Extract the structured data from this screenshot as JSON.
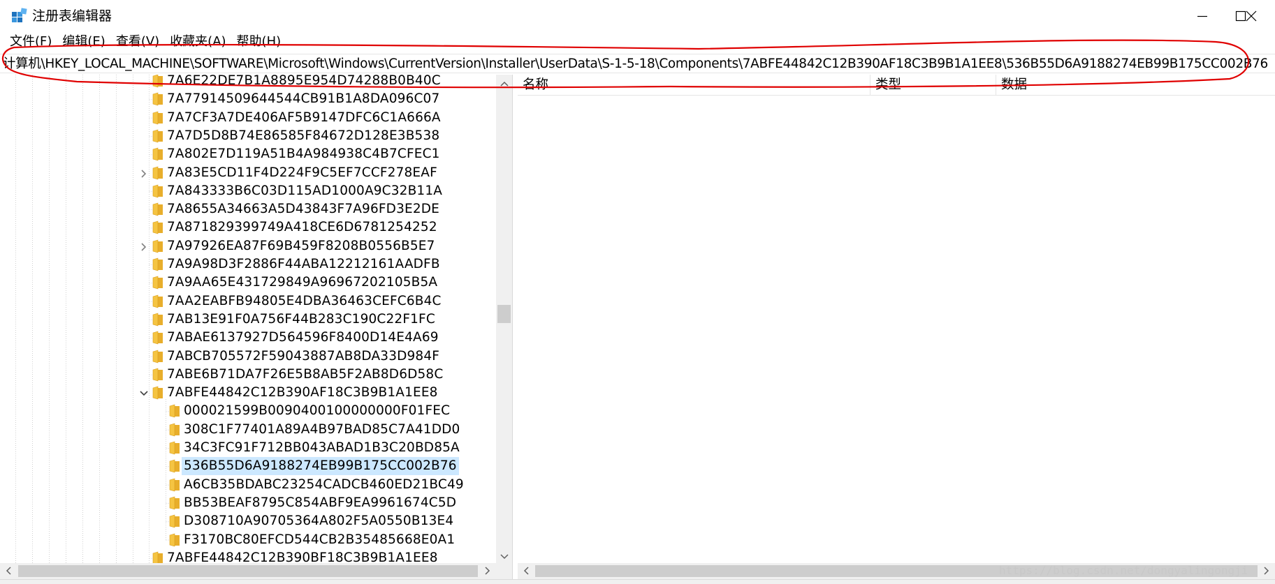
{
  "window": {
    "title": "注册表编辑器",
    "icon": "registry-editor-icon",
    "controls": {
      "minimize": "minimize-icon",
      "maximize": "maximize-icon",
      "close": "close-icon"
    }
  },
  "menu": [
    "文件(F)",
    "编辑(E)",
    "查看(V)",
    "收藏夹(A)",
    "帮助(H)"
  ],
  "address": "计算机\\HKEY_LOCAL_MACHINE\\SOFTWARE\\Microsoft\\Windows\\CurrentVersion\\Installer\\UserData\\S-1-5-18\\Components\\7ABFE44842C12B390AF18C3B9B1A1EE8\\536B55D6A9188274EB99B175CC002B76",
  "tree": {
    "selected_key": "536B55D6A9188274EB99B175CC002B76",
    "items": [
      {
        "label": "7A6E22DE7B1A8895E954D74288B0B40C",
        "level": 0,
        "expander": "none",
        "selected": false
      },
      {
        "label": "7A77914509644544CB91B1A8DA096C07",
        "level": 0,
        "expander": "none",
        "selected": false
      },
      {
        "label": "7A7CF3A7DE406AF5B9147DFC6C1A666A",
        "level": 0,
        "expander": "none",
        "selected": false
      },
      {
        "label": "7A7D5D8B74E86585F84672D128E3B538",
        "level": 0,
        "expander": "none",
        "selected": false
      },
      {
        "label": "7A802E7D119A51B4A984938C4B7CFEC1",
        "level": 0,
        "expander": "none",
        "selected": false
      },
      {
        "label": "7A83E5CD11F4D224F9C5EF7CCF278EAF",
        "level": 0,
        "expander": "collapsed",
        "selected": false
      },
      {
        "label": "7A843333B6C03D115AD1000A9C32B11A",
        "level": 0,
        "expander": "none",
        "selected": false
      },
      {
        "label": "7A8655A34663A5D43843F7A96FD3E2DE",
        "level": 0,
        "expander": "none",
        "selected": false
      },
      {
        "label": "7A871829399749A418CE6D6781254252",
        "level": 0,
        "expander": "none",
        "selected": false
      },
      {
        "label": "7A97926EA87F69B459F8208B0556B5E7",
        "level": 0,
        "expander": "collapsed",
        "selected": false
      },
      {
        "label": "7A9A98D3F2886F44ABA12212161AADFB",
        "level": 0,
        "expander": "none",
        "selected": false
      },
      {
        "label": "7A9AA65E431729849A96967202105B5A",
        "level": 0,
        "expander": "none",
        "selected": false
      },
      {
        "label": "7AA2EABFB94805E4DBA36463CEFC6B4C",
        "level": 0,
        "expander": "none",
        "selected": false
      },
      {
        "label": "7AB13E91F0A756F44B283C190C22F1FC",
        "level": 0,
        "expander": "none",
        "selected": false
      },
      {
        "label": "7ABAE6137927D564596F8400D14E4A69",
        "level": 0,
        "expander": "none",
        "selected": false
      },
      {
        "label": "7ABCB705572F59043887AB8DA33D984F",
        "level": 0,
        "expander": "none",
        "selected": false
      },
      {
        "label": "7ABE6B71DA7F26E5B8AB5F2AB8D6D58C",
        "level": 0,
        "expander": "none",
        "selected": false
      },
      {
        "label": "7ABFE44842C12B390AF18C3B9B1A1EE8",
        "level": 0,
        "expander": "expanded",
        "selected": false
      },
      {
        "label": "000021599B0090400100000000F01FEC",
        "level": 1,
        "expander": "none",
        "selected": false
      },
      {
        "label": "308C1F77401A89A4B97BAD85C7A41DD0",
        "level": 1,
        "expander": "none",
        "selected": false
      },
      {
        "label": "34C3FC91F712BB043ABAD1B3C20BD85A",
        "level": 1,
        "expander": "none",
        "selected": false
      },
      {
        "label": "536B55D6A9188274EB99B175CC002B76",
        "level": 1,
        "expander": "none",
        "selected": true
      },
      {
        "label": "A6CB35BDABC23254CADCB460ED21BC49",
        "level": 1,
        "expander": "none",
        "selected": false
      },
      {
        "label": "BB53BEAF8795C854ABF9EA9961674C5D",
        "level": 1,
        "expander": "none",
        "selected": false
      },
      {
        "label": "D308710A90705364A802F5A0550B13E4",
        "level": 1,
        "expander": "none",
        "selected": false
      },
      {
        "label": "F3170BC80EFCD544CB2B35485668E0A1",
        "level": 1,
        "expander": "none",
        "selected": false
      },
      {
        "label": "7ABFE44842C12B390BF18C3B9B1A1EE8",
        "level": 0,
        "expander": "none",
        "selected": false
      }
    ]
  },
  "list": {
    "columns": [
      "名称",
      "类型",
      "数据"
    ],
    "rows": []
  },
  "watermark": "https://blog.csdn.net/dongyalingongji",
  "colors": {
    "selection": "#cce8ff",
    "folder": "#f5c442",
    "annotation": "#e00000"
  }
}
